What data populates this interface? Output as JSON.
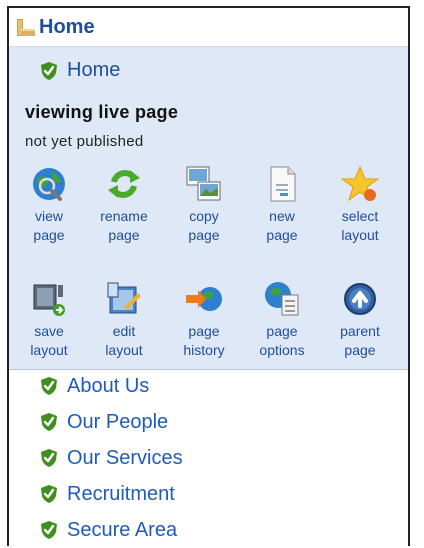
{
  "root": {
    "title": "Home"
  },
  "panel": {
    "current_page": "Home",
    "status_title": "viewing live page",
    "status_sub": "not yet published"
  },
  "tools_row1": [
    {
      "line1": "view",
      "line2": "page",
      "icon": "globe-search-icon"
    },
    {
      "line1": "rename",
      "line2": "page",
      "icon": "refresh-arrows-icon"
    },
    {
      "line1": "copy",
      "line2": "page",
      "icon": "copy-images-icon"
    },
    {
      "line1": "new",
      "line2": "page",
      "icon": "document-icon"
    },
    {
      "line1": "select",
      "line2": "layout",
      "icon": "star-icon"
    }
  ],
  "tools_row2": [
    {
      "line1": "save",
      "line2": "layout",
      "icon": "save-layout-icon"
    },
    {
      "line1": "edit",
      "line2": "layout",
      "icon": "edit-layout-icon"
    },
    {
      "line1": "page",
      "line2": "history",
      "icon": "arrow-globe-icon"
    },
    {
      "line1": "page",
      "line2": "options",
      "icon": "globe-document-icon"
    },
    {
      "line1": "parent",
      "line2": "page",
      "icon": "parent-arrow-icon"
    }
  ],
  "nav": [
    {
      "label": "About Us"
    },
    {
      "label": "Our People"
    },
    {
      "label": "Our Services"
    },
    {
      "label": "Recruitment"
    },
    {
      "label": "Secure Area"
    }
  ],
  "colors": {
    "link": "#1f5bb8",
    "panel_bg": "#dfe8f7",
    "shield": "#3f8f1e"
  }
}
